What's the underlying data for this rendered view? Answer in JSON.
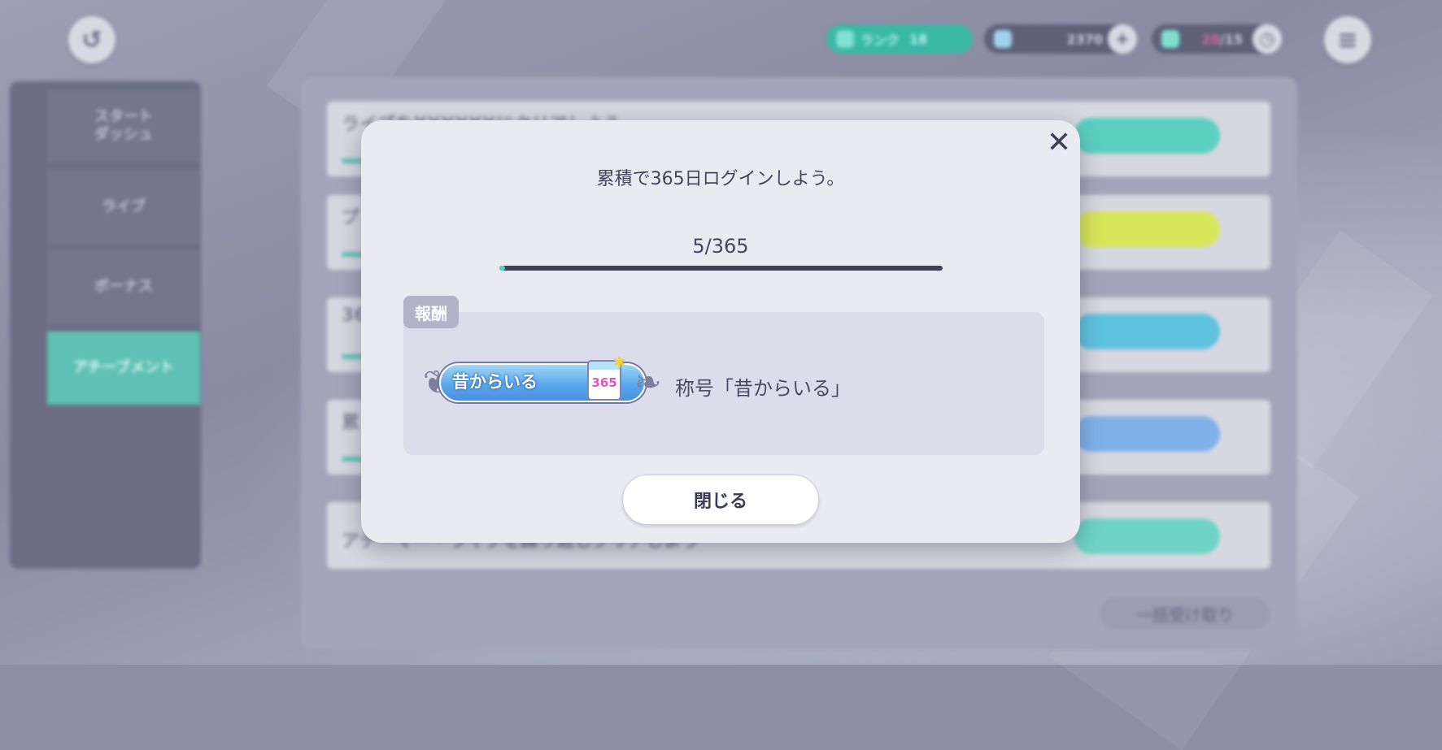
{
  "background": {
    "top_bar": {
      "rank_label": "ランク",
      "rank_value": "18",
      "crystal_count": "2370",
      "stamina_current": "20",
      "stamina_max": "/15"
    },
    "sidebar": {
      "tabs": [
        {
          "label": "スタート\nダッシュ"
        },
        {
          "label": "ライブ"
        },
        {
          "label": "ボーナス"
        },
        {
          "label": "アチーブメント"
        }
      ],
      "active_index": 3
    },
    "list": {
      "rows": [
        "ライブをXXXXXXにクリアしよう",
        "プ",
        "36",
        "累",
        "アテーマー・ライブを繰り返しクリアしよう"
      ],
      "collect_all_label": "一括受け取り"
    }
  },
  "modal": {
    "title": "累積で365日ログインしよう。",
    "progress_text": "5/365",
    "progress": {
      "current": 5,
      "total": 365
    },
    "reward_tag": "報酬",
    "reward_badge_text": "昔からいる",
    "reward_badge_number": "365",
    "reward_name": "称号「昔からいる」",
    "close_button_label": "閉じる"
  },
  "colors": {
    "accent": "#4fd5c2",
    "track": "#3f405c",
    "modal_bg": "#eaeaf1",
    "reward_bg": "#dcdcea",
    "text": "#43445e"
  }
}
